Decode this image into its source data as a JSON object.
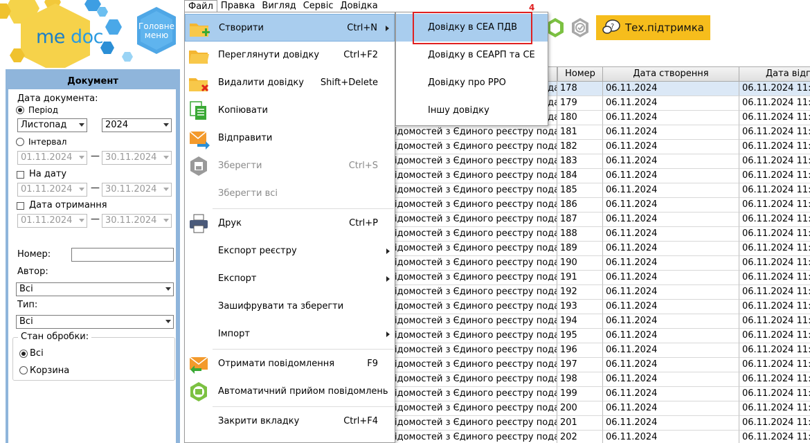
{
  "logo": {
    "me": "me",
    "doc": "doc"
  },
  "home_menu": {
    "label_line1": "Головне",
    "label_line2": "меню"
  },
  "menubar": [
    "Файл",
    "Правка",
    "Вигляд",
    "Сервіс",
    "Довідка"
  ],
  "support_button": {
    "label": "Тех.підтримка"
  },
  "left_panel": {
    "title": "Документ",
    "doc_date_label": "Дата документа:",
    "period_label": "Період",
    "month": "Листопад",
    "year": "2024",
    "interval_label": "Інтервал",
    "interval_from": "01.11.2024",
    "interval_to": "30.11.2024",
    "on_date_label": "На дату",
    "on_date_from": "01.11.2024",
    "on_date_to": "30.11.2024",
    "received_label": "Дата отримання",
    "received_from": "01.11.2024",
    "received_to": "30.11.2024",
    "dash": "—",
    "number_label": "Номер:",
    "author_label": "Автор:",
    "author_value": "Всі",
    "type_label": "Тип:",
    "type_value": "Всі",
    "status_label": "Стан обробки:",
    "status_all": "Всі",
    "status_trash": "Корзина"
  },
  "table": {
    "headers": [
      "",
      "Номер",
      "Дата створення",
      "Дата відп"
    ],
    "doc_text": "ідомостей з Єдиного реєстру подат",
    "rows": [
      {
        "num": "178",
        "created": "06.11.2024",
        "sent": "06.11.2024 11:"
      },
      {
        "num": "179",
        "created": "06.11.2024",
        "sent": "06.11.2024 11:"
      },
      {
        "num": "180",
        "created": "06.11.2024",
        "sent": "06.11.2024 11:"
      },
      {
        "num": "181",
        "created": "06.11.2024",
        "sent": "06.11.2024 11:"
      },
      {
        "num": "182",
        "created": "06.11.2024",
        "sent": "06.11.2024 11:"
      },
      {
        "num": "183",
        "created": "06.11.2024",
        "sent": "06.11.2024 11:"
      },
      {
        "num": "184",
        "created": "06.11.2024",
        "sent": "06.11.2024 11:"
      },
      {
        "num": "185",
        "created": "06.11.2024",
        "sent": "06.11.2024 11:"
      },
      {
        "num": "186",
        "created": "06.11.2024",
        "sent": "06.11.2024 11:"
      },
      {
        "num": "187",
        "created": "06.11.2024",
        "sent": "06.11.2024 11:"
      },
      {
        "num": "188",
        "created": "06.11.2024",
        "sent": "06.11.2024 11:"
      },
      {
        "num": "189",
        "created": "06.11.2024",
        "sent": "06.11.2024 11:"
      },
      {
        "num": "190",
        "created": "06.11.2024",
        "sent": "06.11.2024 11:"
      },
      {
        "num": "191",
        "created": "06.11.2024",
        "sent": "06.11.2024 11:"
      },
      {
        "num": "192",
        "created": "06.11.2024",
        "sent": "06.11.2024 11:"
      },
      {
        "num": "193",
        "created": "06.11.2024",
        "sent": "06.11.2024 11:"
      },
      {
        "num": "194",
        "created": "06.11.2024",
        "sent": "06.11.2024 11:"
      },
      {
        "num": "195",
        "created": "06.11.2024",
        "sent": "06.11.2024 11:"
      },
      {
        "num": "196",
        "created": "06.11.2024",
        "sent": "06.11.2024 11:"
      },
      {
        "num": "197",
        "created": "06.11.2024",
        "sent": "06.11.2024 11:"
      },
      {
        "num": "198",
        "created": "06.11.2024",
        "sent": "06.11.2024 11:"
      },
      {
        "num": "199",
        "created": "06.11.2024",
        "sent": "06.11.2024 11:"
      },
      {
        "num": "200",
        "created": "06.11.2024",
        "sent": "06.11.2024 11:"
      },
      {
        "num": "201",
        "created": "06.11.2024",
        "sent": "06.11.2024 11:"
      },
      {
        "num": "202",
        "created": "06.11.2024",
        "sent": "06.11.2024 11:"
      }
    ]
  },
  "file_menu": {
    "items": [
      {
        "label": "Створити",
        "shortcut": "Ctrl+N"
      },
      {
        "label": "Переглянути довідку",
        "shortcut": "Ctrl+F2"
      },
      {
        "label": "Видалити довідку",
        "shortcut": "Shift+Delete"
      },
      {
        "label": "Копіювати",
        "shortcut": ""
      },
      {
        "label": "Відправити",
        "shortcut": ""
      },
      {
        "label": "Зберегти",
        "shortcut": "Ctrl+S"
      },
      {
        "label": "Зберегти всі",
        "shortcut": ""
      },
      {
        "label": "Друк",
        "shortcut": "Ctrl+P"
      },
      {
        "label": "Експорт реєстру",
        "shortcut": ""
      },
      {
        "label": "Експорт",
        "shortcut": ""
      },
      {
        "label": "Зашифрувати та зберегти",
        "shortcut": ""
      },
      {
        "label": "Імпорт",
        "shortcut": ""
      },
      {
        "label": "Отримати повідомлення",
        "shortcut": "F9"
      },
      {
        "label": "Автоматичний прийом повідомлень",
        "shortcut": ""
      },
      {
        "label": "Закрити вкладку",
        "shortcut": "Ctrl+F4"
      }
    ]
  },
  "create_submenu": {
    "items": [
      "Довідку в СЕА ПДВ",
      "Довідку в СЕАРП та СЕ",
      "Довідку про РРО",
      "Іншу довідку"
    ]
  },
  "step_marker": "4",
  "colors": {
    "highlight": "#a9cdee",
    "panel": "#8fb5db",
    "support": "#f6bd1c",
    "marker": "#e02020"
  }
}
